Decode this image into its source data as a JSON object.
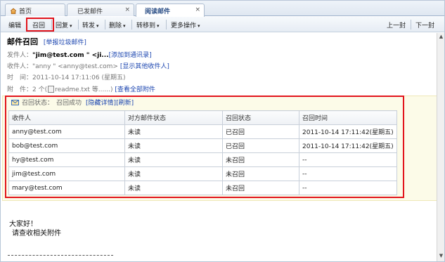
{
  "tabs": [
    {
      "label": "首页",
      "closable": false
    },
    {
      "label": "已发邮件",
      "closable": true
    },
    {
      "label": "阅读邮件",
      "closable": true,
      "active": true
    }
  ],
  "toolbar": {
    "edit": "编辑",
    "recall": "召回",
    "reply": "回复",
    "forward": "转发",
    "delete": "删除",
    "move_to": "转移到",
    "more": "更多操作",
    "prev": "上一封",
    "next": "下一封"
  },
  "mail": {
    "subject": "邮件召回",
    "report_spam": "[举报垃圾邮件]",
    "from_label": "发件人：",
    "from_value": "\"jim@test.com \" <ji...",
    "add_contact": "[添加到通讯录]",
    "to_label": "收件人：",
    "to_value": "\"anny \" <anny@test.com>",
    "show_recipients": "[显示其他收件人]",
    "time_label": "时　间：",
    "time_value": "2011-10-14 17:11:06 (星期五)",
    "attach_label": "附　件：",
    "attach_count": "2 个(",
    "attach_file": "readme.txt 等......)",
    "view_all_attach": "[查看全部附件"
  },
  "recall": {
    "status_label": "召回状态：",
    "status_value": "召回成功",
    "hide_details": "[隐藏详情]",
    "refresh": "[刷新]",
    "columns": [
      "收件人",
      "对方邮件状态",
      "召回状态",
      "召回时间"
    ],
    "rows": [
      [
        "anny@test.com",
        "未读",
        "已召回",
        "2011-10-14 17:11:42(星期五)"
      ],
      [
        "bob@test.com",
        "未读",
        "已召回",
        "2011-10-14 17:11:42(星期五)"
      ],
      [
        "hy@test.com",
        "未读",
        "未召回",
        "--"
      ],
      [
        "jim@test.com",
        "未读",
        "未召回",
        "--"
      ],
      [
        "mary@test.com",
        "未读",
        "未召回",
        "--"
      ]
    ]
  },
  "body": {
    "line1": "大家好！",
    "line2": "请查收相关附件"
  },
  "colors": {
    "highlight_red": "#e2141c",
    "link_blue": "#1c46b0",
    "panel_bg": "#fcfbe8"
  }
}
